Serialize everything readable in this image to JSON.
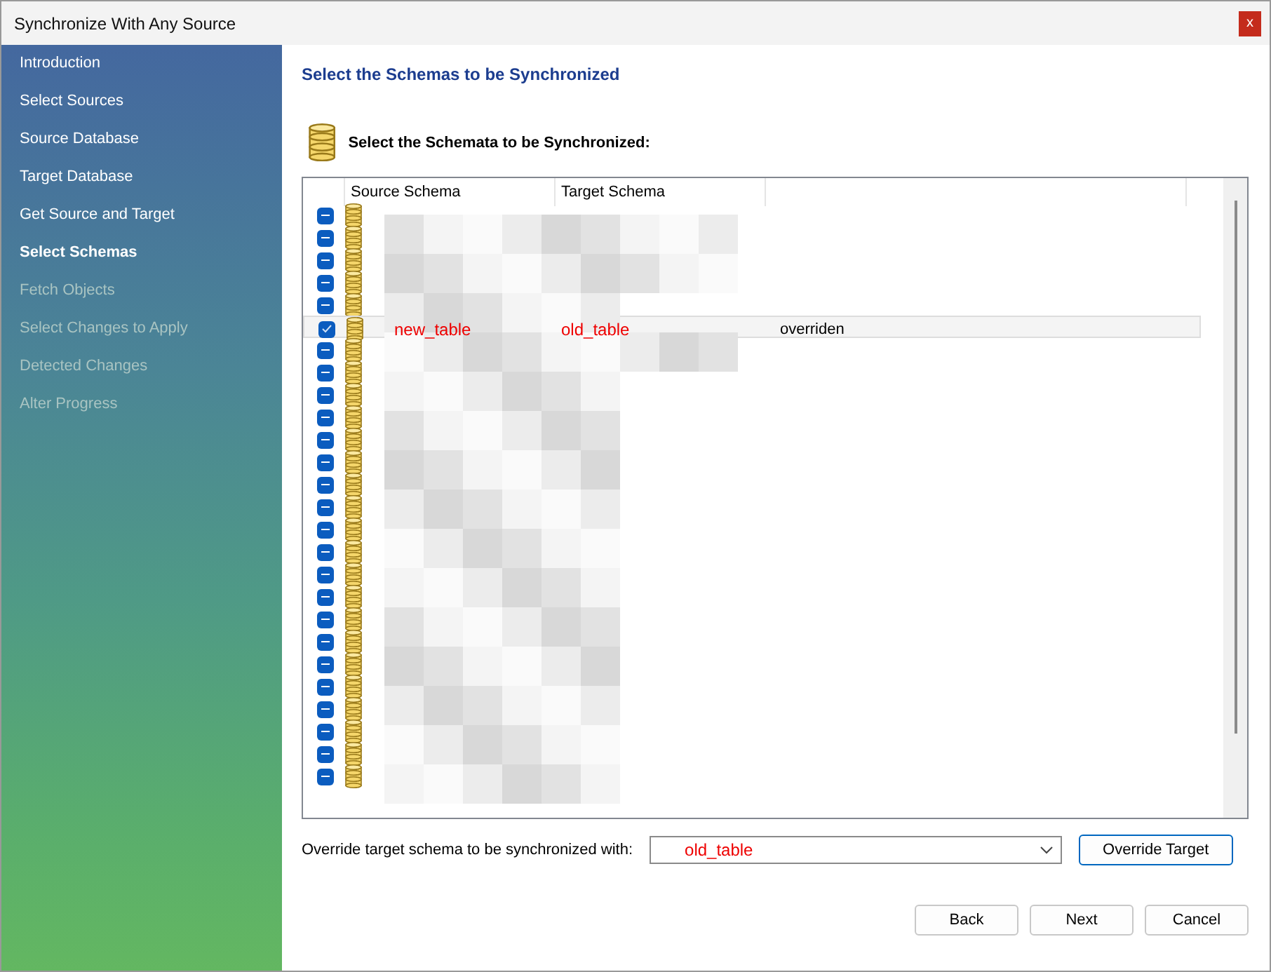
{
  "window": {
    "title": "Synchronize With Any Source",
    "close": "x"
  },
  "sidebar": {
    "items": [
      {
        "label": "Introduction",
        "selected": false,
        "disabled": false
      },
      {
        "label": "Select Sources",
        "selected": false,
        "disabled": false
      },
      {
        "label": "Source Database",
        "selected": false,
        "disabled": false
      },
      {
        "label": "Target Database",
        "selected": false,
        "disabled": false
      },
      {
        "label": "Get Source and Target",
        "selected": false,
        "disabled": false
      },
      {
        "label": "Select Schemas",
        "selected": true,
        "disabled": false
      },
      {
        "label": "Fetch Objects",
        "selected": false,
        "disabled": true
      },
      {
        "label": "Select Changes to Apply",
        "selected": false,
        "disabled": true
      },
      {
        "label": "Detected Changes",
        "selected": false,
        "disabled": true
      },
      {
        "label": "Alter Progress",
        "selected": false,
        "disabled": true
      }
    ]
  },
  "page": {
    "title": "Select the Schemas to be Synchronized",
    "subtitle": "Select the Schemata to be Synchronized:"
  },
  "table": {
    "columns": [
      "Source Schema",
      "Target Schema"
    ],
    "rows": [
      {
        "checked": true,
        "indeterminate": true,
        "selected": false
      },
      {
        "checked": true,
        "indeterminate": true,
        "selected": false
      },
      {
        "checked": true,
        "indeterminate": true,
        "selected": false
      },
      {
        "checked": true,
        "indeterminate": true,
        "selected": false
      },
      {
        "checked": true,
        "indeterminate": true,
        "selected": false
      },
      {
        "checked": true,
        "indeterminate": false,
        "selected": true,
        "source": "new_table",
        "target": "old_table",
        "status": "overriden"
      },
      {
        "checked": true,
        "indeterminate": true,
        "selected": false
      },
      {
        "checked": true,
        "indeterminate": true,
        "selected": false
      },
      {
        "checked": true,
        "indeterminate": true,
        "selected": false
      },
      {
        "checked": true,
        "indeterminate": true,
        "selected": false
      },
      {
        "checked": true,
        "indeterminate": true,
        "selected": false
      },
      {
        "checked": true,
        "indeterminate": true,
        "selected": false
      },
      {
        "checked": true,
        "indeterminate": true,
        "selected": false
      },
      {
        "checked": true,
        "indeterminate": true,
        "selected": false
      },
      {
        "checked": true,
        "indeterminate": true,
        "selected": false
      },
      {
        "checked": true,
        "indeterminate": true,
        "selected": false
      },
      {
        "checked": true,
        "indeterminate": true,
        "selected": false
      },
      {
        "checked": true,
        "indeterminate": true,
        "selected": false
      },
      {
        "checked": true,
        "indeterminate": true,
        "selected": false
      },
      {
        "checked": true,
        "indeterminate": true,
        "selected": false
      },
      {
        "checked": true,
        "indeterminate": true,
        "selected": false
      },
      {
        "checked": true,
        "indeterminate": true,
        "selected": false
      },
      {
        "checked": true,
        "indeterminate": true,
        "selected": false
      },
      {
        "checked": true,
        "indeterminate": true,
        "selected": false
      },
      {
        "checked": true,
        "indeterminate": true,
        "selected": false
      },
      {
        "checked": true,
        "indeterminate": true,
        "selected": false
      }
    ]
  },
  "override": {
    "label": "Override target schema to be synchronized with:",
    "value": "old_table",
    "button": "Override Target"
  },
  "buttons": [
    "Back",
    "Next",
    "Cancel"
  ]
}
